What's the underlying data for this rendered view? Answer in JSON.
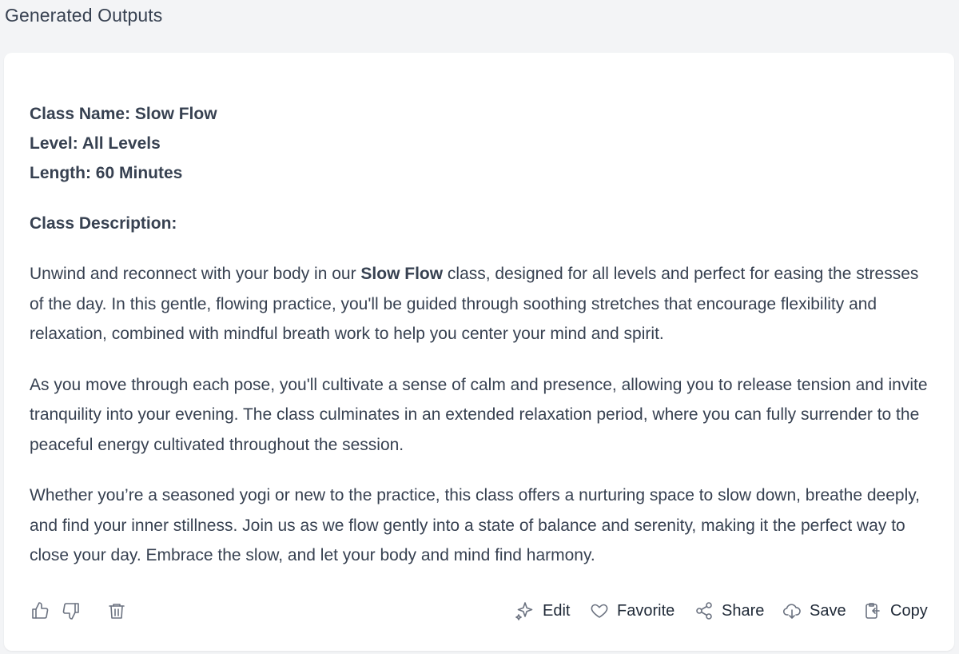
{
  "header": {
    "title": "Generated Outputs"
  },
  "output": {
    "class_name": "Class Name: Slow Flow",
    "level": "Level: All Levels",
    "length": "Length: 60 Minutes",
    "description_heading": "Class Description:",
    "para1": {
      "before": "Unwind and reconnect with your body in our ",
      "bold": "Slow Flow",
      "after": " class, designed for all levels and perfect for easing the stresses of the day. In this gentle, flowing practice, you'll be guided through soothing stretches that encourage flexibility and relaxation, combined with mindful breath work to help you center your mind and spirit."
    },
    "para2": "As you move through each pose, you'll cultivate a sense of calm and presence, allowing you to release tension and invite tranquility into your evening. The class culminates in an extended relaxation period, where you can fully surrender to the peaceful energy cultivated throughout the session.",
    "para3": "Whether you’re a seasoned yogi or new to the practice, this class offers a nurturing space to slow down, breathe deeply, and find your inner stillness. Join us as we flow gently into a state of balance and serenity, making it the perfect way to close your day. Embrace the slow, and let your body and mind find harmony."
  },
  "actions": {
    "thumbs_up_icon": "thumbs-up-icon",
    "thumbs_down_icon": "thumbs-down-icon",
    "trash_icon": "trash-icon",
    "edit_label": "Edit",
    "favorite_label": "Favorite",
    "share_label": "Share",
    "save_label": "Save",
    "copy_label": "Copy"
  },
  "colors": {
    "background": "#f3f4f6",
    "card": "#ffffff",
    "text": "#374151",
    "icon": "#6b7280"
  }
}
